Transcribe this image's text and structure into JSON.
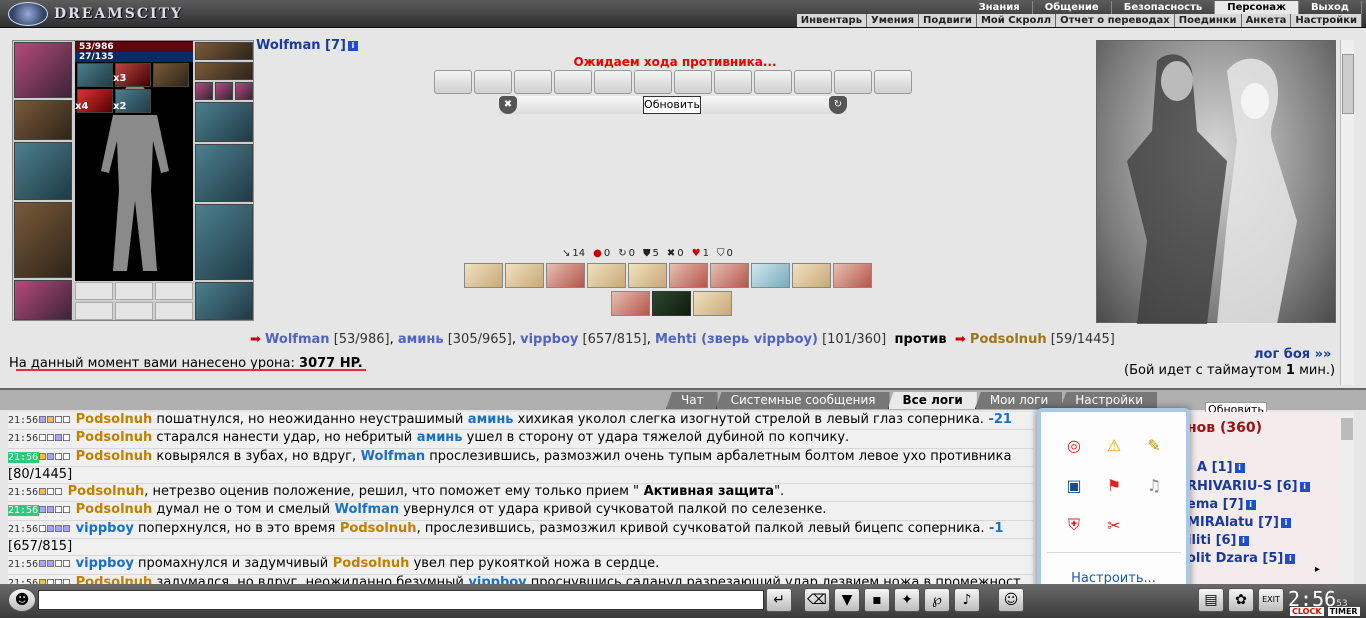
{
  "app": {
    "logo_text": "DREAMSCITY"
  },
  "menu_top": [
    "Знания",
    "Общение",
    "Безопасность",
    "Персонаж",
    "Выход"
  ],
  "menu_sub": [
    "Инвентарь",
    "Умения",
    "Подвиги",
    "Мой Скролл",
    "Отчет о переводах",
    "Поединки",
    "Анкета",
    "Настройки"
  ],
  "character": {
    "name": "Wolfman [7]",
    "hp": "53/986",
    "mana": "27/135",
    "counts": {
      "a": "x3",
      "b": "x4",
      "c": "x2"
    }
  },
  "battle": {
    "waiting": "Ожидаем хода противника...",
    "refresh": "Обновить",
    "stats": [
      {
        "icon": "↘",
        "v": "14"
      },
      {
        "icon": "●",
        "v": "0"
      },
      {
        "icon": "↻",
        "v": "0"
      },
      {
        "icon": "⛊",
        "v": "5"
      },
      {
        "icon": "✖",
        "v": "0"
      },
      {
        "icon": "♥",
        "v": "1"
      },
      {
        "icon": "⛉",
        "v": "0"
      }
    ],
    "team_left": [
      {
        "name": "Wolfman",
        "hp": "[53/986]"
      },
      {
        "name": "аминь",
        "hp": "[305/965]"
      },
      {
        "name": "vippboy",
        "hp": "[657/815]"
      },
      {
        "name": "Mehti (зверь vippboy)",
        "hp": "[101/360]"
      }
    ],
    "vs": "против",
    "team_right": [
      {
        "name": "Podsolnuh",
        "hp": "[59/1445]"
      }
    ],
    "damage_label": "На данный момент вами нанесено урона:",
    "damage_value": "3077 HP.",
    "battle_log_link": "лог боя »»",
    "timeout_prefix": "(Бой идет с таймаутом",
    "timeout_value": "1",
    "timeout_suffix": "мин.)"
  },
  "tabs": [
    "Чат",
    "Системные сообщения",
    "Все логи",
    "Мои логи",
    "Настройки"
  ],
  "log": [
    {
      "time": "21:56",
      "parts": [
        [
          "n",
          "Podsolnuh"
        ],
        [
          "",
          "пошатнулся, но неожиданно неустрашимый"
        ],
        [
          "c",
          "аминь"
        ],
        [
          "",
          "хихикая уколол слегка изогнутой стрелой в левый глаз соперника."
        ],
        [
          "c",
          "-21"
        ]
      ]
    },
    {
      "time": "21:56",
      "parts": [
        [
          "n",
          "Podsolnuh"
        ],
        [
          "",
          "старался нанести удар, но небритый"
        ],
        [
          "c",
          "аминь"
        ],
        [
          "",
          "ушел в сторону от удара тяжелой дубиной по копчику."
        ]
      ]
    },
    {
      "time": "21:56",
      "hl": true,
      "parts": [
        [
          "n",
          "Podsolnuh"
        ],
        [
          "",
          "ковырялся в зубах, но вдруг,"
        ],
        [
          "c",
          "Wolfman"
        ],
        [
          "",
          "прослезившись, размозжил очень тупым арбалетным болтом левое ухо противника"
        ]
      ]
    },
    {
      "time": "",
      "parts": [
        [
          "",
          "[80/1445]"
        ]
      ]
    },
    {
      "time": "21:56",
      "parts": [
        [
          "n",
          "Podsolnuh"
        ],
        [
          "",
          ", нетрезво оценив положение, решил, что поможет ему только прием \""
        ],
        [
          "b",
          "Активная защита"
        ],
        [
          "",
          "\"."
        ]
      ]
    },
    {
      "time": "21:56",
      "hl": true,
      "parts": [
        [
          "n",
          "Podsolnuh"
        ],
        [
          "",
          "думал не о том и смелый"
        ],
        [
          "c",
          "Wolfman"
        ],
        [
          "",
          "увернулся от удара кривой сучковатой палкой по селезенке."
        ]
      ]
    },
    {
      "time": "21:56",
      "parts": [
        [
          "c",
          "vippboy"
        ],
        [
          "",
          "поперхнулся, но в это время"
        ],
        [
          "n",
          "Podsolnuh"
        ],
        [
          "",
          ", прослезившись, размозжил кривой сучковатой палкой левый бицепс соперника."
        ],
        [
          "c",
          "-1"
        ]
      ]
    },
    {
      "time": "",
      "parts": [
        [
          "",
          "[657/815]"
        ]
      ]
    },
    {
      "time": "21:56",
      "parts": [
        [
          "c",
          "vippboy"
        ],
        [
          "",
          "промахнулся и задумчивый"
        ],
        [
          "n",
          "Podsolnuh"
        ],
        [
          "",
          "увел пер рукояткой ножа в сердце."
        ]
      ]
    },
    {
      "time": "21:56",
      "parts": [
        [
          "n",
          "Podsolnuh"
        ],
        [
          "",
          "задумался, но вдруг, неожиданно безумный"
        ],
        [
          "c",
          "vippboy"
        ],
        [
          "",
          "проснувшись саданул разрезающий удар лезвием ножа в промежност"
        ]
      ]
    }
  ],
  "players": {
    "title": "нов (360)",
    "refresh": "Обновить",
    "list": [
      "A [1]",
      "RHIVARIU-S [6]",
      "ema [7]",
      "MIRAlatu [7]",
      "iliti [6]",
      "olit Dzara [5]"
    ]
  },
  "tray_popup": {
    "configure": "Настроить..."
  },
  "clock": {
    "time": "2:56",
    "seconds": "53",
    "label_clock": "CLOCK",
    "label_timer": "TIMER"
  }
}
